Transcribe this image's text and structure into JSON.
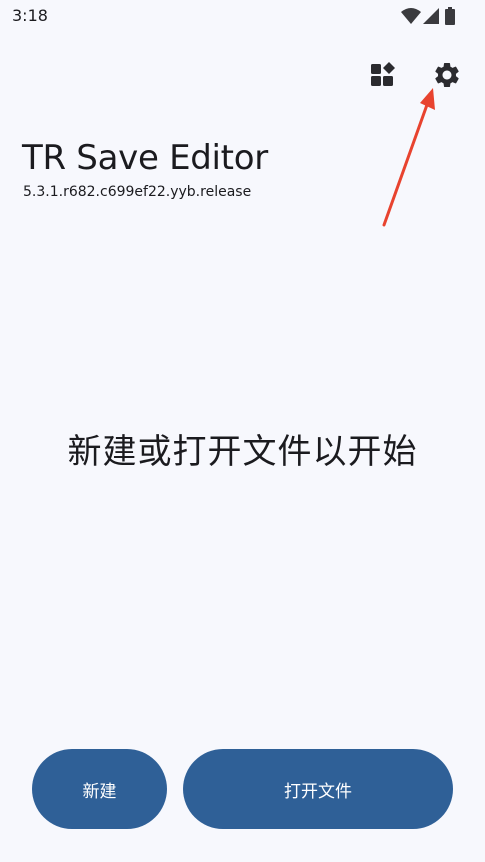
{
  "status_bar": {
    "time": "3:18",
    "icons": [
      "wifi-icon",
      "cellular-signal-icon",
      "battery-icon"
    ]
  },
  "toolbar": {
    "icons": [
      "widgets-icon",
      "settings-gear-icon"
    ]
  },
  "app": {
    "title": "TR Save Editor",
    "version": "5.3.1.r682.c699ef22.yyb.release"
  },
  "main": {
    "empty_hint": "新建或打开文件以开始"
  },
  "actions": {
    "new_label": "新建",
    "open_label": "打开文件"
  },
  "colors": {
    "background": "#f7f8fd",
    "primary_button": "#2f6097",
    "annotation_arrow": "#e8432f"
  }
}
